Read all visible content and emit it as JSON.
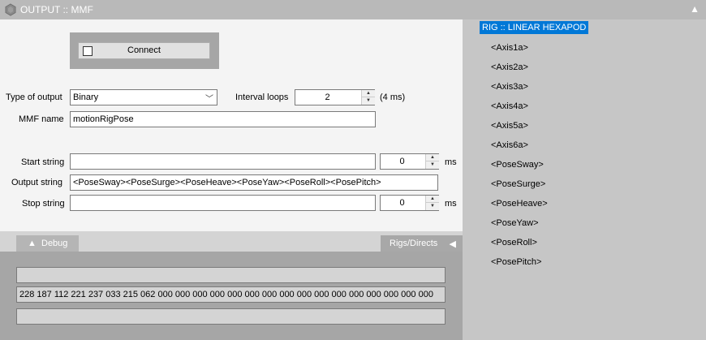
{
  "window": {
    "title": "OUTPUT :: MMF",
    "collapse_icon": "triangle-up-icon",
    "logo_icon": "hexagon-logo-icon"
  },
  "connect": {
    "label": "Connect",
    "checked": false
  },
  "form": {
    "type_of_output_label": "Type of output",
    "type_of_output_value": "Binary",
    "interval_loops_label": "Interval loops",
    "interval_loops_value": "2",
    "interval_ms": "(4 ms)",
    "mmf_name_label": "MMF name",
    "mmf_name_value": "motionRigPose",
    "start_string_label": "Start string",
    "start_string_value": "",
    "start_delay_value": "0",
    "start_ms": "ms",
    "output_string_label": "Output string",
    "output_string_value": "<PoseSway><PoseSurge><PoseHeave><PoseYaw><PoseRoll><PosePitch>",
    "stop_string_label": "Stop string",
    "stop_string_value": "",
    "stop_delay_value": "0",
    "stop_ms": "ms"
  },
  "tabs": {
    "debug_label": "Debug",
    "debug_icon": "triangle-up-icon",
    "rigs_label": "Rigs/Directs",
    "rigs_icon": "triangle-left-icon"
  },
  "debug": {
    "line1": "",
    "line2": "228 187 112 221 237 033 215 062 000 000 000 000 000 000 000 000 000 000 000 000 000 000 000 000",
    "line3": ""
  },
  "rig": {
    "title": "RIG :: LINEAR HEXAPOD",
    "items": [
      "<Axis1a>",
      "<Axis2a>",
      "<Axis3a>",
      "<Axis4a>",
      "<Axis5a>",
      "<Axis6a>",
      "<PoseSway>",
      "<PoseSurge>",
      "<PoseHeave>",
      "<PoseYaw>",
      "<PoseRoll>",
      "<PosePitch>"
    ]
  },
  "colors": {
    "selection": "#0078d7",
    "panel": "#f4f4f4",
    "frame": "#a6a6a6",
    "side": "#c6c6c6"
  }
}
